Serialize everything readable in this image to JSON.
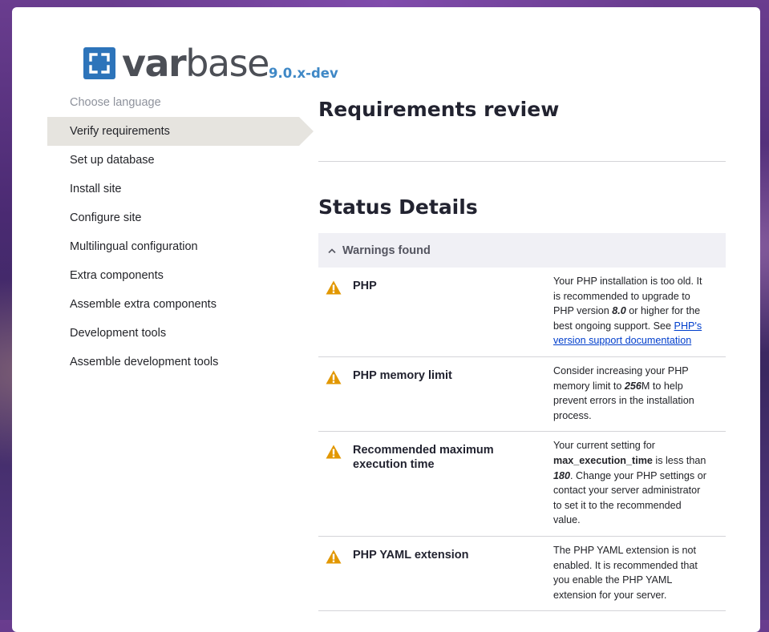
{
  "brand": {
    "logo_text_bold": "var",
    "logo_text_rest": "base",
    "version": "9.0.x-dev",
    "brand_color": "#2d74ba"
  },
  "steps": [
    {
      "label": "Choose language",
      "state": "done"
    },
    {
      "label": "Verify requirements",
      "state": "active"
    },
    {
      "label": "Set up database",
      "state": "pending"
    },
    {
      "label": "Install site",
      "state": "pending"
    },
    {
      "label": "Configure site",
      "state": "pending"
    },
    {
      "label": "Multilingual configuration",
      "state": "pending"
    },
    {
      "label": "Extra components",
      "state": "pending"
    },
    {
      "label": "Assemble extra components",
      "state": "pending"
    },
    {
      "label": "Development tools",
      "state": "pending"
    },
    {
      "label": "Assemble development tools",
      "state": "pending"
    }
  ],
  "page_title": "Requirements review",
  "section_title": "Status Details",
  "group": {
    "title": "Warnings found",
    "icon": "chevron-up-icon"
  },
  "warnings": [
    {
      "title": "PHP",
      "icon": "warning-icon",
      "desc_1": "Your PHP installation is too old. It is recommended to upgrade to PHP version ",
      "desc_value": "8.0",
      "desc_2": " or higher for the best ongoing support. See ",
      "link_text": "PHP's version support documentation"
    },
    {
      "title": "PHP memory limit",
      "icon": "warning-icon",
      "desc_1": "Consider increasing your PHP memory limit to ",
      "desc_value": "256",
      "desc_2": "M to help prevent errors in the installation process."
    },
    {
      "title": "Recommended maximum execution time",
      "icon": "warning-icon",
      "desc_1": "Your current setting for ",
      "desc_strong": "max_execution_time",
      "desc_2": " is less than ",
      "desc_value": "180",
      "desc_3": ". Change your PHP settings or contact your server administrator to set it to the recommended value."
    },
    {
      "title": "PHP YAML extension",
      "icon": "warning-icon",
      "desc_1": "The PHP YAML extension is not enabled. It is recommended that you enable the PHP YAML extension for your server."
    }
  ],
  "colors": {
    "warning": "#e29700",
    "link": "#003ecc",
    "active_step_bg": "#e6e4df"
  }
}
